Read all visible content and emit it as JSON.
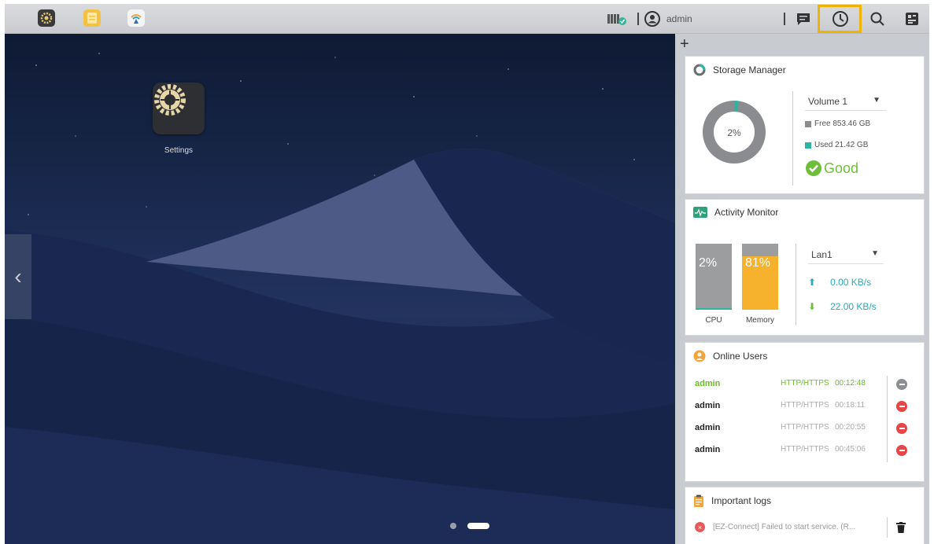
{
  "taskbar": {
    "apps": [
      {
        "name": "settings-app",
        "icon": "gear-icon"
      },
      {
        "name": "notes-app",
        "icon": "note-icon"
      },
      {
        "name": "ez-connect-app",
        "icon": "ez-connect-icon"
      }
    ],
    "username": "admin",
    "icons": [
      "storage-status-icon",
      "user-icon",
      "message-icon",
      "dashboard-icon",
      "search-icon",
      "widget-icon"
    ]
  },
  "desktop": {
    "apps": [
      {
        "label": "Settings",
        "icon": "gear-icon"
      }
    ],
    "pager": {
      "pages": 2,
      "current": 2
    }
  },
  "widgets": {
    "storage": {
      "title": "Storage Manager",
      "used_pct_label": "2%",
      "used_fraction": 0.024,
      "volume": "Volume 1",
      "free": "Free 853.46 GB",
      "used": "Used 21.42 GB",
      "status": "Good",
      "colors": {
        "free": "#8a8c8f",
        "used": "#2fb4a2",
        "good": "#6dbf3a"
      }
    },
    "activity": {
      "title": "Activity Monitor",
      "cpu_label": "2%",
      "cpu_fraction": 0.02,
      "cpu_caption": "CPU",
      "memory_label": "81%",
      "memory_fraction": 0.81,
      "memory_caption": "Memory",
      "interface": "Lan1",
      "upload": "0.00 KB/s",
      "download": "22.00 KB/s",
      "colors": {
        "cpu": "#2fb4a2",
        "memory": "#f6b12d"
      }
    },
    "online_users": {
      "title": "Online Users",
      "rows": [
        {
          "name": "admin",
          "protocol": "HTTP/HTTPS",
          "time": "00:12:48",
          "active": true
        },
        {
          "name": "admin",
          "protocol": "HTTP/HTTPS",
          "time": "00:18:11",
          "active": false
        },
        {
          "name": "admin",
          "protocol": "HTTP/HTTPS",
          "time": "00:20:55",
          "active": false
        },
        {
          "name": "admin",
          "protocol": "HTTP/HTTPS",
          "time": "00:45:06",
          "active": false
        }
      ]
    },
    "logs": {
      "title": "Important logs",
      "entries": [
        "[EZ-Connect] Failed to start service. (R..."
      ]
    }
  }
}
